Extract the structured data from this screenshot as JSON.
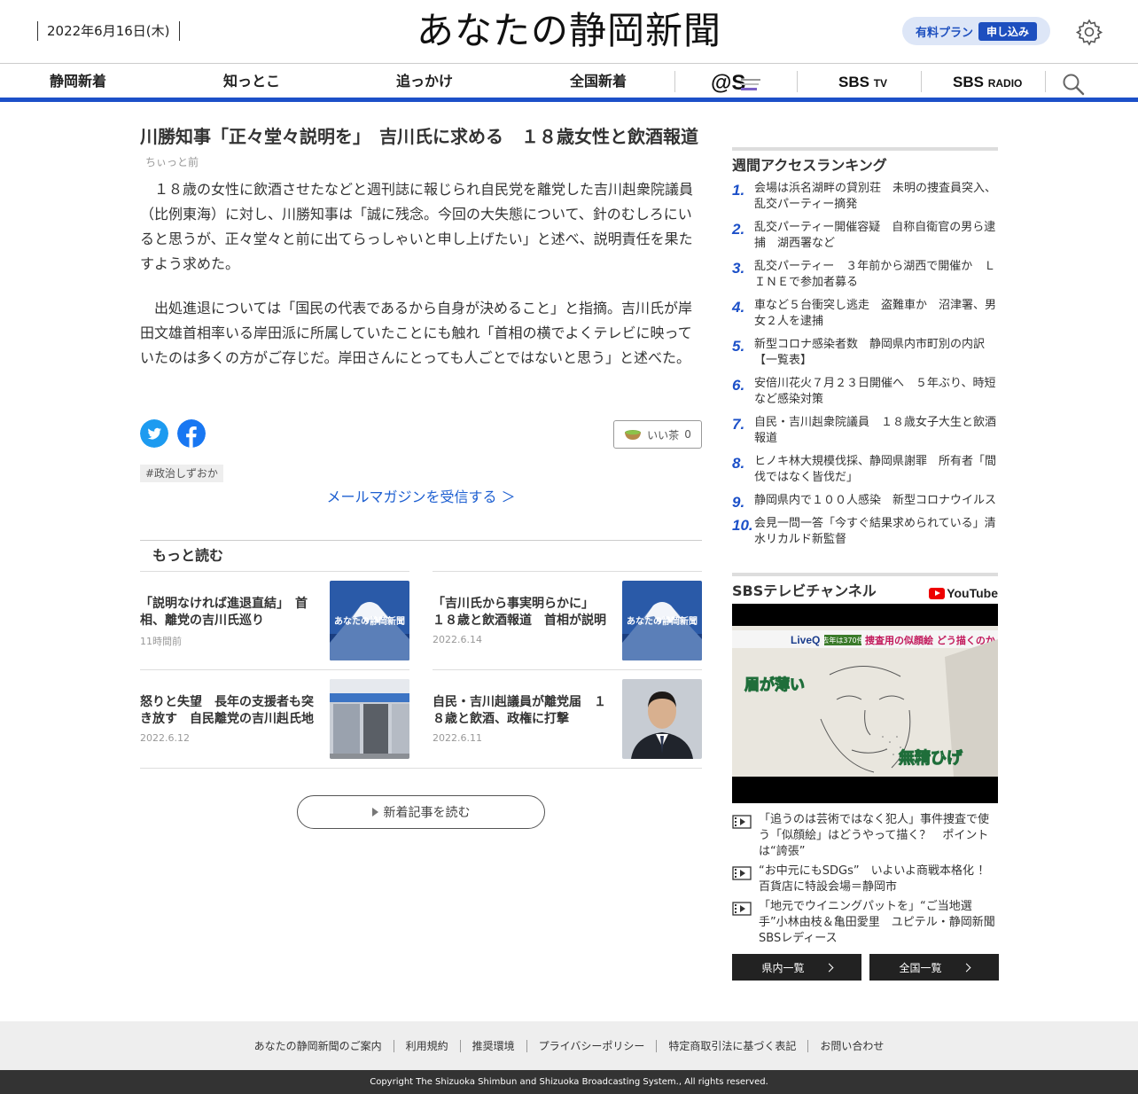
{
  "header": {
    "date": "2022年6月16日(木)",
    "logo": "あなたの静岡新聞",
    "plan_label": "有料プラン",
    "plan_button": "申し込み"
  },
  "nav": {
    "items": [
      "静岡新着",
      "知っとこ",
      "追っかけ",
      "全国新着"
    ],
    "sbs_tv": "SBS",
    "sbs_tv_suffix": "TV",
    "sbs_radio": "SBS",
    "sbs_radio_suffix": "RADIO"
  },
  "article": {
    "headline": "川勝知事「正々堂々説明を」　吉川氏に求める　１８歳女性と飲酒報道",
    "time": "ちぃっと前",
    "paragraphs": [
      "１８歳の女性に飲酒させたなどと週刊誌に報じられ自民党を離党した吉川赳衆院議員（比例東海）に対し、川勝知事は「誠に残念。今回の大失態について、針のむしろにいると思うが、正々堂々と前に出てらっしゃいと申し上げたい」と述べ、説明責任を果たすよう求めた。",
      "出処進退については「国民の代表であるから自身が決めること」と指摘。吉川氏が岸田文雄首相率いる岸田派に所属していたことにも触れ「首相の横でよくテレビに映っていたのは多くの方がご存じだ。岸田さんにとっても人ごとではないと思う」と述べた。"
    ],
    "tea_label": "いい茶",
    "tea_count": "0",
    "tag": "#政治しずおか",
    "mail_link": "メールマガジンを受信する ＞"
  },
  "more": {
    "title": "もっと読む",
    "cards": [
      {
        "title": "「説明なければ進退直結」　首相、離党の吉川氏巡り",
        "date": "11時間前"
      },
      {
        "title": "「吉川氏から事実明らかに」　１８歳と飲酒報道　首相が説明求める",
        "date": "2022.6.14"
      },
      {
        "title": "怒りと失望　長年の支援者も突き放す　自民離党の吉川赳氏地元",
        "date": "2022.6.12"
      },
      {
        "title": "自民・吉川赳議員が離党届　１８歳と飲酒、政権に打撃",
        "date": "2022.6.11"
      }
    ],
    "thumb_text": "あなたの静岡新聞",
    "read_more": "新着記事を読む"
  },
  "ranking": {
    "title": "週間アクセスランキング",
    "items": [
      {
        "num": "1.",
        "text": "会場は浜名湖畔の貸別荘　未明の捜査員突入、乱交パーティー摘発"
      },
      {
        "num": "2.",
        "text": "乱交パーティー開催容疑　自称自衛官の男ら逮捕　湖西署など"
      },
      {
        "num": "3.",
        "text": "乱交パーティー　３年前から湖西で開催か　ＬＩＮＥで参加者募る"
      },
      {
        "num": "4.",
        "text": "車など５台衝突し逃走　盗難車か　沼津署、男女２人を逮捕"
      },
      {
        "num": "5.",
        "text": "新型コロナ感染者数　静岡県内市町別の内訳【一覧表】"
      },
      {
        "num": "6.",
        "text": "安倍川花火７月２３日開催へ　５年ぶり、時短など感染対策"
      },
      {
        "num": "7.",
        "text": "自民・吉川赳衆院議員　１８歳女子大生と飲酒報道"
      },
      {
        "num": "8.",
        "text": "ヒノキ林大規模伐採、静岡県謝罪　所有者「間伐ではなく皆伐だ」"
      },
      {
        "num": "9.",
        "text": "静岡県内で１００人感染　新型コロナウイルス"
      },
      {
        "num": "10.",
        "text": "会見一問一答「今すぐ結果求められている」清水リカルド新監督"
      }
    ]
  },
  "tv": {
    "title": "SBSテレビチャンネル",
    "youtube": "YouTube",
    "video_caption_left": "眉が薄い",
    "video_caption_right": "無精ひげ",
    "video_banner": "LiveQ",
    "video_banner_sub": "去年は370件",
    "video_banner_text": "捜査用の似顔絵 どう描くのか",
    "videos": [
      "「追うのは芸術ではなく犯人」事件捜査で使う「似顔絵」はどうやって描く？　ポイントは“誇張”",
      "“お中元にもSDGs”　いよいよ商戦本格化 ！百貨店に特設会場＝静岡市",
      "「地元でウイニングパットを」“ご当地選手”小林由枝＆亀田愛里　ユピテル・静岡新聞SBSレディース"
    ],
    "btn_local": "県内一覧",
    "btn_national": "全国一覧"
  },
  "footer": {
    "links": [
      "あなたの静岡新聞のご案内",
      "利用規約",
      "推奨環境",
      "プライバシーポリシー",
      "特定商取引法に基づく表記",
      "お問い合わせ"
    ],
    "copyright": "Copyright The Shizuoka Shimbun and Shizuoka Broadcasting System., All rights reserved."
  },
  "colors": {
    "accent": "#1c50c8",
    "link": "#1d5fd1",
    "twitter": "#1d9bf0",
    "facebook": "#1877f2"
  }
}
